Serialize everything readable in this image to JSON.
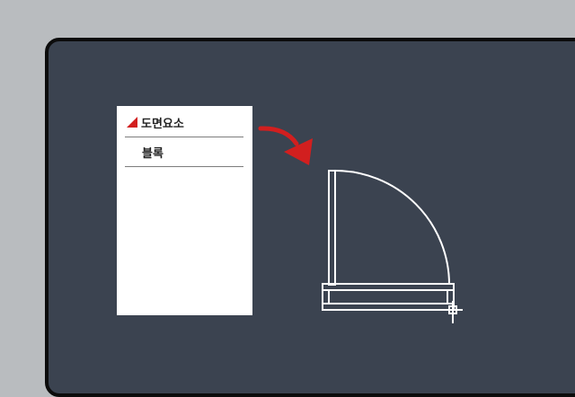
{
  "panel": {
    "items": [
      {
        "label": "도면요소",
        "active": true
      },
      {
        "label": "블록",
        "active": false
      }
    ]
  },
  "colors": {
    "screen_bg": "#3b4350",
    "bezel": "#0c0c0c",
    "accent": "#d21f1f",
    "page_bg": "#b9bcbf"
  },
  "icons": [
    "curved-arrow-icon",
    "door-block-icon",
    "active-marker-icon"
  ]
}
